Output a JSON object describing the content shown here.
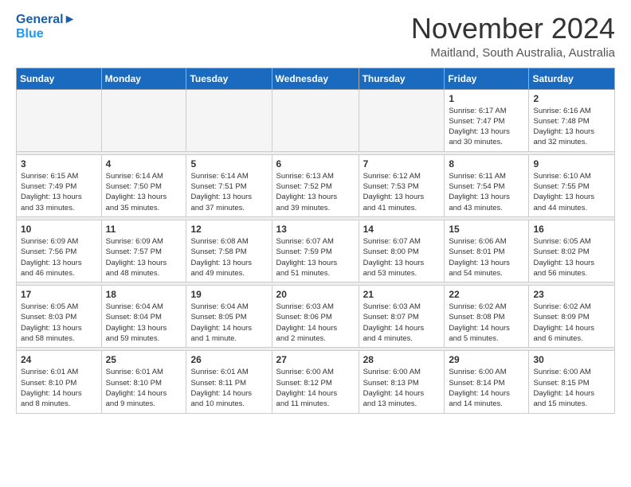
{
  "header": {
    "logo_text_general": "General",
    "logo_text_blue": "Blue",
    "month": "November 2024",
    "location": "Maitland, South Australia, Australia"
  },
  "weekdays": [
    "Sunday",
    "Monday",
    "Tuesday",
    "Wednesday",
    "Thursday",
    "Friday",
    "Saturday"
  ],
  "weeks": [
    [
      {
        "day": "",
        "detail": ""
      },
      {
        "day": "",
        "detail": ""
      },
      {
        "day": "",
        "detail": ""
      },
      {
        "day": "",
        "detail": ""
      },
      {
        "day": "",
        "detail": ""
      },
      {
        "day": "1",
        "detail": "Sunrise: 6:17 AM\nSunset: 7:47 PM\nDaylight: 13 hours\nand 30 minutes."
      },
      {
        "day": "2",
        "detail": "Sunrise: 6:16 AM\nSunset: 7:48 PM\nDaylight: 13 hours\nand 32 minutes."
      }
    ],
    [
      {
        "day": "3",
        "detail": "Sunrise: 6:15 AM\nSunset: 7:49 PM\nDaylight: 13 hours\nand 33 minutes."
      },
      {
        "day": "4",
        "detail": "Sunrise: 6:14 AM\nSunset: 7:50 PM\nDaylight: 13 hours\nand 35 minutes."
      },
      {
        "day": "5",
        "detail": "Sunrise: 6:14 AM\nSunset: 7:51 PM\nDaylight: 13 hours\nand 37 minutes."
      },
      {
        "day": "6",
        "detail": "Sunrise: 6:13 AM\nSunset: 7:52 PM\nDaylight: 13 hours\nand 39 minutes."
      },
      {
        "day": "7",
        "detail": "Sunrise: 6:12 AM\nSunset: 7:53 PM\nDaylight: 13 hours\nand 41 minutes."
      },
      {
        "day": "8",
        "detail": "Sunrise: 6:11 AM\nSunset: 7:54 PM\nDaylight: 13 hours\nand 43 minutes."
      },
      {
        "day": "9",
        "detail": "Sunrise: 6:10 AM\nSunset: 7:55 PM\nDaylight: 13 hours\nand 44 minutes."
      }
    ],
    [
      {
        "day": "10",
        "detail": "Sunrise: 6:09 AM\nSunset: 7:56 PM\nDaylight: 13 hours\nand 46 minutes."
      },
      {
        "day": "11",
        "detail": "Sunrise: 6:09 AM\nSunset: 7:57 PM\nDaylight: 13 hours\nand 48 minutes."
      },
      {
        "day": "12",
        "detail": "Sunrise: 6:08 AM\nSunset: 7:58 PM\nDaylight: 13 hours\nand 49 minutes."
      },
      {
        "day": "13",
        "detail": "Sunrise: 6:07 AM\nSunset: 7:59 PM\nDaylight: 13 hours\nand 51 minutes."
      },
      {
        "day": "14",
        "detail": "Sunrise: 6:07 AM\nSunset: 8:00 PM\nDaylight: 13 hours\nand 53 minutes."
      },
      {
        "day": "15",
        "detail": "Sunrise: 6:06 AM\nSunset: 8:01 PM\nDaylight: 13 hours\nand 54 minutes."
      },
      {
        "day": "16",
        "detail": "Sunrise: 6:05 AM\nSunset: 8:02 PM\nDaylight: 13 hours\nand 56 minutes."
      }
    ],
    [
      {
        "day": "17",
        "detail": "Sunrise: 6:05 AM\nSunset: 8:03 PM\nDaylight: 13 hours\nand 58 minutes."
      },
      {
        "day": "18",
        "detail": "Sunrise: 6:04 AM\nSunset: 8:04 PM\nDaylight: 13 hours\nand 59 minutes."
      },
      {
        "day": "19",
        "detail": "Sunrise: 6:04 AM\nSunset: 8:05 PM\nDaylight: 14 hours\nand 1 minute."
      },
      {
        "day": "20",
        "detail": "Sunrise: 6:03 AM\nSunset: 8:06 PM\nDaylight: 14 hours\nand 2 minutes."
      },
      {
        "day": "21",
        "detail": "Sunrise: 6:03 AM\nSunset: 8:07 PM\nDaylight: 14 hours\nand 4 minutes."
      },
      {
        "day": "22",
        "detail": "Sunrise: 6:02 AM\nSunset: 8:08 PM\nDaylight: 14 hours\nand 5 minutes."
      },
      {
        "day": "23",
        "detail": "Sunrise: 6:02 AM\nSunset: 8:09 PM\nDaylight: 14 hours\nand 6 minutes."
      }
    ],
    [
      {
        "day": "24",
        "detail": "Sunrise: 6:01 AM\nSunset: 8:10 PM\nDaylight: 14 hours\nand 8 minutes."
      },
      {
        "day": "25",
        "detail": "Sunrise: 6:01 AM\nSunset: 8:10 PM\nDaylight: 14 hours\nand 9 minutes."
      },
      {
        "day": "26",
        "detail": "Sunrise: 6:01 AM\nSunset: 8:11 PM\nDaylight: 14 hours\nand 10 minutes."
      },
      {
        "day": "27",
        "detail": "Sunrise: 6:00 AM\nSunset: 8:12 PM\nDaylight: 14 hours\nand 11 minutes."
      },
      {
        "day": "28",
        "detail": "Sunrise: 6:00 AM\nSunset: 8:13 PM\nDaylight: 14 hours\nand 13 minutes."
      },
      {
        "day": "29",
        "detail": "Sunrise: 6:00 AM\nSunset: 8:14 PM\nDaylight: 14 hours\nand 14 minutes."
      },
      {
        "day": "30",
        "detail": "Sunrise: 6:00 AM\nSunset: 8:15 PM\nDaylight: 14 hours\nand 15 minutes."
      }
    ]
  ]
}
